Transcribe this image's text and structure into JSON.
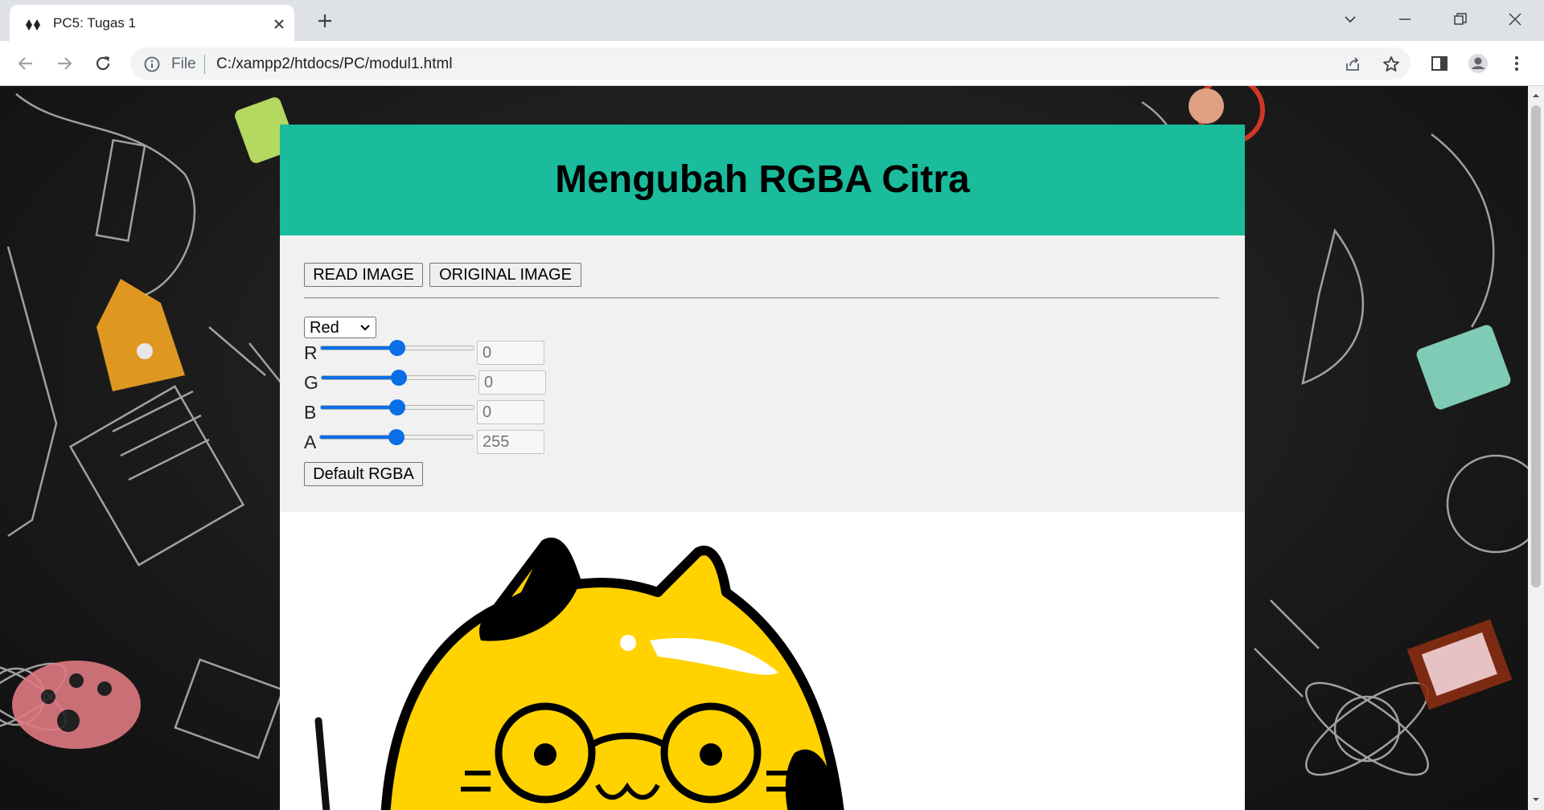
{
  "browser": {
    "tab_title": "PC5: Tugas 1",
    "url_scheme": "File",
    "url": "C:/xampp2/htdocs/PC/modul1.html"
  },
  "page": {
    "title": "Mengubah RGBA Citra",
    "read_button": "READ IMAGE",
    "original_button": "ORIGINAL IMAGE",
    "channel_select": {
      "value": "Red"
    },
    "sliders": [
      {
        "label": "R",
        "value": "0",
        "position": 0.5
      },
      {
        "label": "G",
        "value": "0",
        "position": 0.5
      },
      {
        "label": "B",
        "value": "0",
        "position": 0.5
      },
      {
        "label": "A",
        "value": "255",
        "position": 0.5
      }
    ],
    "default_button": "Default RGBA"
  },
  "colors": {
    "header_bg": "#1abc9c",
    "controls_bg": "#f1f1f1",
    "slider_accent": "#0a6ee6",
    "cat_yellow": "#ffd200"
  }
}
